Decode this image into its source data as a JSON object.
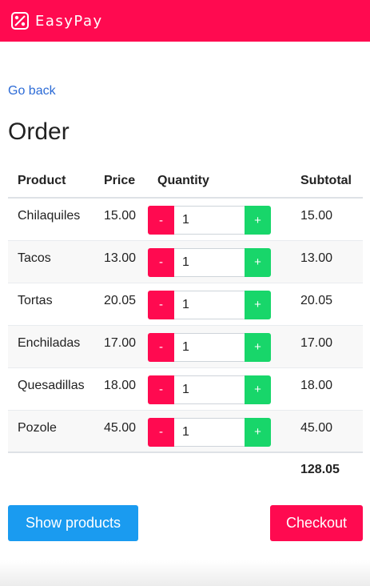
{
  "header": {
    "logo_icon": "easypay-logo-icon",
    "title": "EasyPay",
    "color": "#ff0a50"
  },
  "nav": {
    "go_back": "Go back"
  },
  "page": {
    "title": "Order"
  },
  "table": {
    "headers": {
      "product": "Product",
      "price": "Price",
      "quantity": "Quantity",
      "subtotal": "Subtotal"
    },
    "rows": [
      {
        "product": "Chilaquiles",
        "price": "15.00",
        "quantity": "1",
        "subtotal": "15.00"
      },
      {
        "product": "Tacos",
        "price": "13.00",
        "quantity": "1",
        "subtotal": "13.00"
      },
      {
        "product": "Tortas",
        "price": "20.05",
        "quantity": "1",
        "subtotal": "20.05"
      },
      {
        "product": "Enchiladas",
        "price": "17.00",
        "quantity": "1",
        "subtotal": "17.00"
      },
      {
        "product": "Quesadillas",
        "price": "18.00",
        "quantity": "1",
        "subtotal": "18.00"
      },
      {
        "product": "Pozole",
        "price": "45.00",
        "quantity": "1",
        "subtotal": "45.00"
      }
    ],
    "minus_label": "-",
    "plus_label": "+",
    "total": "128.05"
  },
  "actions": {
    "show_products": "Show products",
    "checkout": "Checkout"
  },
  "colors": {
    "brand": "#ff0a50",
    "plus": "#18d66a",
    "primary": "#1a9bf0",
    "link": "#2c6bd6"
  }
}
